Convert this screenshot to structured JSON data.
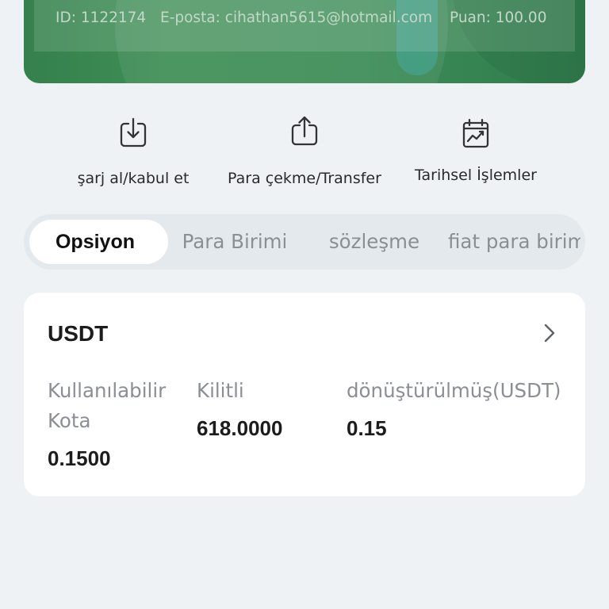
{
  "account": {
    "id_text": "ID: 1122174",
    "email_text": "E-posta: cihathan5615@hotmail.com",
    "score_text": "Puan: 100.00"
  },
  "actions": [
    {
      "icon": "download-icon",
      "label": "şarj al/kabul et"
    },
    {
      "icon": "upload-icon",
      "label": "Para çekme/Transfer"
    },
    {
      "icon": "calendar-chart-icon",
      "label": "Tarihsel İşlemler"
    }
  ],
  "tabs": [
    {
      "label": "Opsiyon",
      "active": true
    },
    {
      "label": "Para Birimi",
      "active": false
    },
    {
      "label": "sözleşme",
      "active": false
    },
    {
      "label": "fiat para birim",
      "active": false
    }
  ],
  "asset_card": {
    "currency": "USDT",
    "columns": [
      {
        "label": "Kullanılabilir Kota",
        "value": "0.1500"
      },
      {
        "label": "Kilitli",
        "value": "618.0000"
      },
      {
        "label": "dönüştürülmüş(USDT)",
        "value": "0.15"
      }
    ]
  },
  "colors": {
    "page_background": "#eef2f5",
    "brand_green": "#3c8c57",
    "tab_track": "#e4e9ed",
    "text_primary": "#1c1c1c",
    "text_muted": "#8b8f94"
  }
}
